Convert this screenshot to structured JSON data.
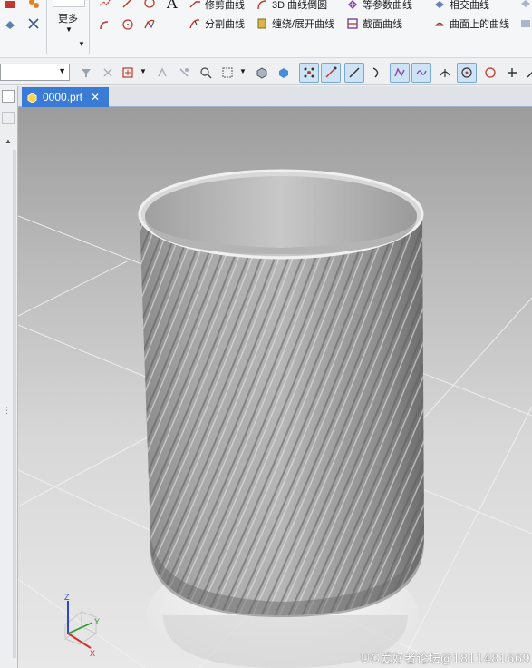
{
  "ribbon": {
    "more_label": "更多",
    "commands": [
      {
        "label": "修剪曲线",
        "icon": "trim-curve-icon"
      },
      {
        "label": "3D 曲线倒圆",
        "icon": "3d-curve-fillet-icon"
      },
      {
        "label": "等参数曲线",
        "icon": "isoparametric-curve-icon"
      },
      {
        "label": "相交曲线",
        "icon": "intersection-curve-icon"
      },
      {
        "label": "分割曲线",
        "icon": "divide-curve-icon"
      },
      {
        "label": "缠绕/展开曲线",
        "icon": "wrap-unwrap-curve-icon"
      },
      {
        "label": "截面曲线",
        "icon": "section-curve-icon"
      },
      {
        "label": "曲面上的曲线",
        "icon": "curve-on-surface-icon"
      }
    ]
  },
  "document": {
    "tab_label": "0000.prt",
    "close_glyph": "✕"
  },
  "triad": {
    "z": "Z",
    "y": "Y",
    "x": "X"
  },
  "watermark": "UG爱好者论坛@1811481669",
  "colors": {
    "tab_active": "#3a7bd5",
    "viewport_top": "#9c9c9c",
    "viewport_bottom": "#e8e8e8",
    "axis_x": "#d03030",
    "axis_y": "#2f9a2f",
    "axis_z": "#2e46c8"
  }
}
